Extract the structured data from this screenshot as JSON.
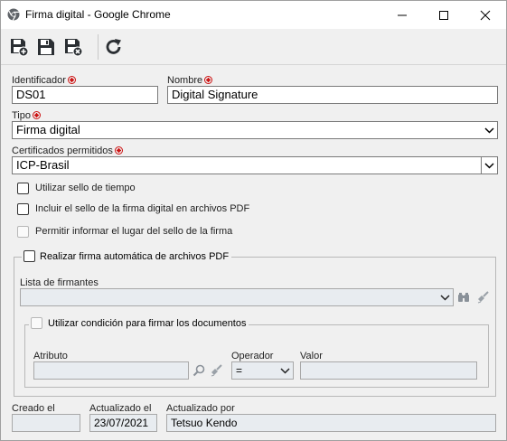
{
  "window": {
    "title": "Firma digital - Google Chrome",
    "minimize_icon": "minimize-icon",
    "maximize_icon": "maximize-icon",
    "close_icon": "close-icon"
  },
  "toolbar": {
    "buttons": [
      {
        "name": "save-new-button",
        "icon": "save-new-icon"
      },
      {
        "name": "save-button",
        "icon": "save-icon"
      },
      {
        "name": "save-close-button",
        "icon": "save-close-icon"
      },
      {
        "name": "refresh-button",
        "icon": "refresh-icon"
      }
    ]
  },
  "form": {
    "identificador": {
      "label": "Identificador",
      "value": "DS01",
      "required": true
    },
    "nombre": {
      "label": "Nombre",
      "value": "Digital Signature",
      "required": true
    },
    "tipo": {
      "label": "Tipo",
      "value": "Firma digital",
      "required": true
    },
    "certificados": {
      "label": "Certificados permitidos",
      "value": "ICP-Brasil",
      "required": true
    },
    "opt_sello_tiempo": {
      "label": "Utilizar sello de tiempo",
      "checked": false
    },
    "opt_sello_pdf": {
      "label": "Incluir el sello de la firma digital en archivos PDF",
      "checked": false
    },
    "opt_lugar_sello": {
      "label": "Permitir informar el lugar del sello de la firma",
      "checked": false,
      "disabled": true
    },
    "auto_firma": {
      "legend": "Realizar firma automática de archivos PDF",
      "checked": false,
      "lista_label": "Lista de firmantes",
      "lista_value": "",
      "condicion": {
        "legend": "Utilizar condición para firmar los documentos",
        "checked": false,
        "atributo_label": "Atributo",
        "atributo_value": "",
        "operador_label": "Operador",
        "operador_value": "=",
        "valor_label": "Valor",
        "valor_value": ""
      }
    },
    "creado_el": {
      "label": "Creado el",
      "value": ""
    },
    "actualizado_el": {
      "label": "Actualizado el",
      "value": "23/07/2021"
    },
    "actualizado_por": {
      "label": "Actualizado por",
      "value": "Tetsuo Kendo"
    }
  },
  "colors": {
    "required_mark": "#cc1111",
    "disabled_field": "#e8ecf0",
    "window_bg": "#f0f0f0"
  }
}
